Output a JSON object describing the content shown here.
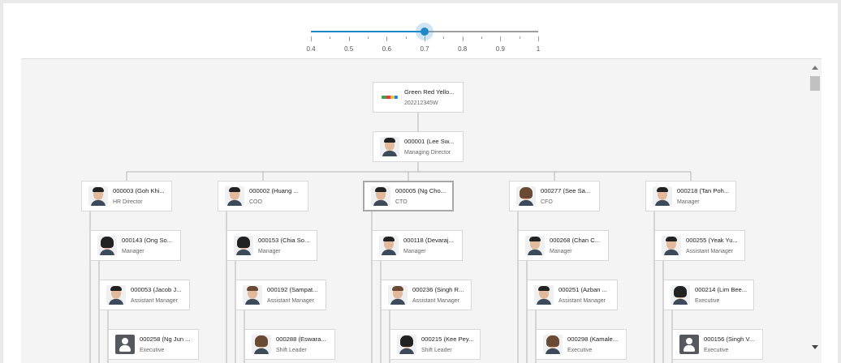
{
  "zoom_slider": {
    "value": 0.7,
    "min": 0.4,
    "max": 1,
    "tick_labels": [
      "0.4",
      "0.5",
      "0.6",
      "0.7",
      "0.8",
      "0.9",
      "1"
    ]
  },
  "colors": {
    "accent": "#1e88c8",
    "canvas": "#f4f4f4",
    "connector": "#b5b5b5"
  },
  "org_chart": {
    "root": {
      "name": "Green Red Yello...",
      "role": "202212345W",
      "icon": "company-logo-icon"
    },
    "ceo": {
      "name": "000001 (Lee Sw...",
      "role": "Managing Director",
      "icon": "person-photo"
    },
    "columns": [
      {
        "head": {
          "name": "000003 (Goh Khi...",
          "role": "HR Director"
        },
        "chain": [
          {
            "name": "000143 (Ong So...",
            "role": "Manager"
          },
          {
            "name": "000053 (Jacob J...",
            "role": "Assistant Manager"
          },
          {
            "name": "000258 (Ng Jun ...",
            "role": "Executive"
          }
        ]
      },
      {
        "head": {
          "name": "000002 (Huang ...",
          "role": "COO"
        },
        "chain": [
          {
            "name": "000153 (Chia So...",
            "role": "Manager"
          },
          {
            "name": "000192 (Sampat...",
            "role": "Assistant Manager"
          },
          {
            "name": "000288 (Eswara...",
            "role": "Shift Leader"
          }
        ]
      },
      {
        "head": {
          "name": "000005 (Ng Cho...",
          "role": "CTO"
        },
        "chain": [
          {
            "name": "000118 (Devaraj...",
            "role": "Manager"
          },
          {
            "name": "000236 (Singh R...",
            "role": "Assistant Manager"
          },
          {
            "name": "000215 (Kee Pey...",
            "role": "Shift Leader"
          }
        ]
      },
      {
        "head": {
          "name": "000277 (See Sa...",
          "role": "CFO"
        },
        "chain": [
          {
            "name": "000268 (Chan C...",
            "role": "Manager"
          },
          {
            "name": "000251 (Azban ...",
            "role": "Assistant Manager"
          },
          {
            "name": "000298 (Kamale...",
            "role": "Executive"
          }
        ]
      },
      {
        "head": {
          "name": "000218 (Tan Poh...",
          "role": "Manager"
        },
        "chain": [
          {
            "name": "000255 (Yeak Yu...",
            "role": "Assistant Manager"
          },
          {
            "name": "000214 (Lim Bee...",
            "role": "Executive"
          },
          {
            "name": "000156 (Singh V...",
            "role": "Executive"
          }
        ]
      }
    ]
  }
}
